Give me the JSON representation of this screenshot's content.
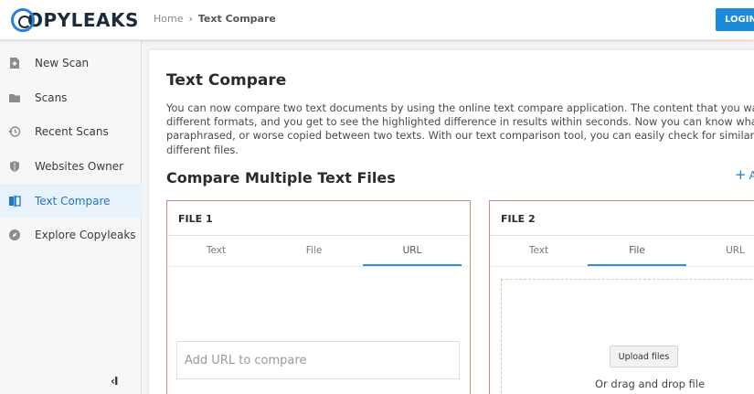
{
  "header": {
    "logo_text": "OPYLEAKS",
    "breadcrumb_home": "Home",
    "breadcrumb_sep": "›",
    "breadcrumb_current": "Text Compare",
    "login_label": "LOGIN"
  },
  "sidebar": {
    "items": [
      {
        "label": "New Scan",
        "icon": "new-scan-icon"
      },
      {
        "label": "Scans",
        "icon": "folder-icon"
      },
      {
        "label": "Recent Scans",
        "icon": "history-icon"
      },
      {
        "label": "Websites Owner",
        "icon": "shield-icon"
      },
      {
        "label": "Text Compare",
        "icon": "text-compare-icon",
        "active": true
      },
      {
        "label": "Explore Copyleaks",
        "icon": "compass-icon"
      }
    ],
    "collapse_label": "‹I"
  },
  "main": {
    "title": "Text Compare",
    "intro_lines": [
      "You can now compare two text documents by using the online text compare application. The content that you want to compare c",
      "different formats, and you get to see the highlighted difference in results within seconds. Now you can know what exactly has be",
      "paraphrased, or worse copied between two texts. With our text comparison tool, you can easily check for similarities between tw",
      "different files."
    ],
    "section_title": "Compare Multiple Text Files",
    "add_link": "A",
    "add_plus": "+",
    "file1": {
      "title": "FILE 1",
      "tabs": [
        "Text",
        "File",
        "URL"
      ],
      "active_tab": "URL",
      "url_placeholder": "Add URL to compare"
    },
    "file2": {
      "title": "FILE 2",
      "tabs": [
        "Text",
        "File",
        "URL"
      ],
      "active_tab": "File",
      "upload_label": "Upload files",
      "drop_text": "Or drag and drop file"
    }
  },
  "colors": {
    "accent": "#1f78c8",
    "login_bg": "#1a8ad9",
    "panel_border": "#c98b7b",
    "dropzone_border": "#b9d8a9"
  }
}
